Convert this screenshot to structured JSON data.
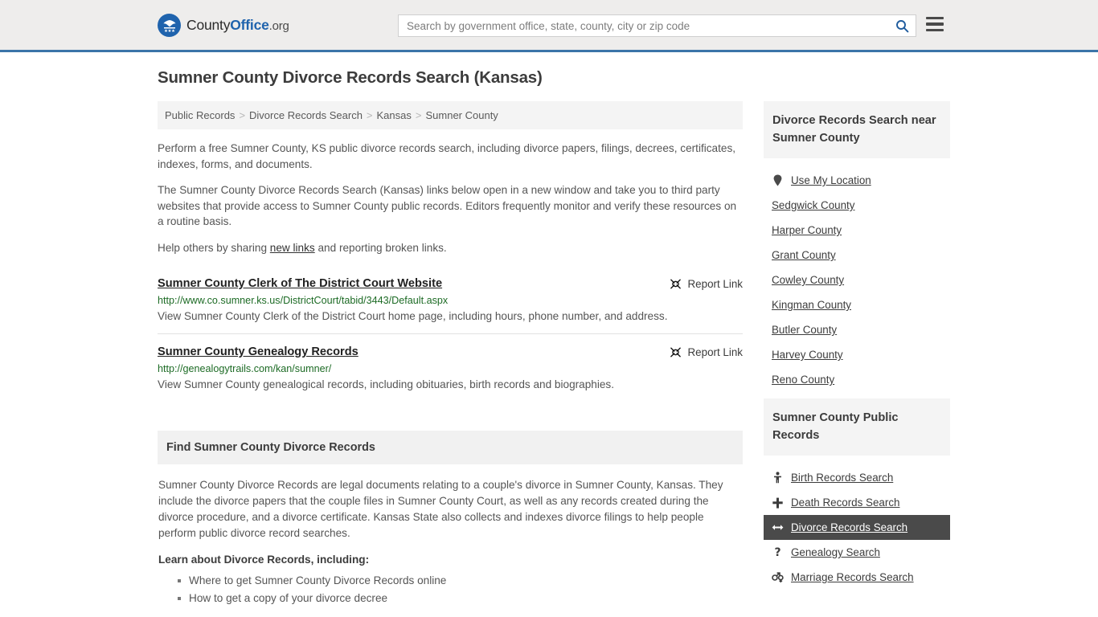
{
  "header": {
    "logo": {
      "part1": "County",
      "part2": "Office",
      "part3": ".org",
      "emblem_icon": "eagle-shield-icon"
    },
    "search": {
      "placeholder": "Search by government office, state, county, city or zip code",
      "value": "",
      "search_icon": "search-icon"
    },
    "menu_icon": "hamburger-menu-icon",
    "accent_color": "#3b74a8",
    "background_color": "#eeedec"
  },
  "page_title": "Sumner County Divorce Records Search (Kansas)",
  "breadcrumb": {
    "separator": ">",
    "items": [
      {
        "label": "Public Records"
      },
      {
        "label": "Divorce Records Search"
      },
      {
        "label": "Kansas"
      },
      {
        "label": "Sumner County"
      }
    ]
  },
  "intro": {
    "p1": "Perform a free Sumner County, KS public divorce records search, including divorce papers, filings, decrees, certificates, indexes, forms, and documents.",
    "p2": "The Sumner County Divorce Records Search (Kansas) links below open in a new window and take you to third party websites that provide access to Sumner County public records. Editors frequently monitor and verify these resources on a routine basis.",
    "p3_before": "Help others by sharing ",
    "p3_link": "new links",
    "p3_after": " and reporting broken links."
  },
  "results": [
    {
      "title": "Sumner County Clerk of The District Court Website",
      "url": "http://www.co.sumner.ks.us/DistrictCourt/tabid/3443/Default.aspx",
      "description": "View Sumner County Clerk of the District Court home page, including hours, phone number, and address.",
      "report_label": "Report Link",
      "report_icon": "broken-link-icon"
    },
    {
      "title": "Sumner County Genealogy Records",
      "url": "http://genealogytrails.com/kan/sumner/",
      "description": "View Sumner County genealogical records, including obituaries, birth records and biographies.",
      "report_label": "Report Link",
      "report_icon": "broken-link-icon"
    }
  ],
  "find_section": {
    "heading": "Find Sumner County Divorce Records",
    "body": "Sumner County Divorce Records are legal documents relating to a couple's divorce in Sumner County, Kansas. They include the divorce papers that the couple files in Sumner County Court, as well as any records created during the divorce procedure, and a divorce certificate. Kansas State also collects and indexes divorce filings to help people perform public divorce record searches.",
    "learn_heading": "Learn about Divorce Records, including:",
    "learn_items": [
      "Where to get Sumner County Divorce Records online",
      "How to get a copy of your divorce decree"
    ]
  },
  "sidebar": {
    "nearby_card": {
      "heading": "Divorce Records Search near Sumner County",
      "items": [
        {
          "label": "Use My Location",
          "icon": "map-pin-icon",
          "has_icon": true
        },
        {
          "label": "Sedgwick County",
          "icon": "",
          "has_icon": false
        },
        {
          "label": "Harper County",
          "icon": "",
          "has_icon": false
        },
        {
          "label": "Grant County",
          "icon": "",
          "has_icon": false
        },
        {
          "label": "Cowley County",
          "icon": "",
          "has_icon": false
        },
        {
          "label": "Kingman County",
          "icon": "",
          "has_icon": false
        },
        {
          "label": "Butler County",
          "icon": "",
          "has_icon": false
        },
        {
          "label": "Harvey County",
          "icon": "",
          "has_icon": false
        },
        {
          "label": "Reno County",
          "icon": "",
          "has_icon": false
        }
      ]
    },
    "public_records_card": {
      "heading": "Sumner County Public Records",
      "items": [
        {
          "label": "Birth Records Search",
          "icon": "baby-icon",
          "active": false
        },
        {
          "label": "Death Records Search",
          "icon": "cross-icon",
          "active": false
        },
        {
          "label": "Divorce Records Search",
          "icon": "left-right-arrow-icon",
          "active": true
        },
        {
          "label": "Genealogy Search",
          "icon": "question-mark-icon",
          "active": false
        },
        {
          "label": "Marriage Records Search",
          "icon": "male-female-icon",
          "active": false
        }
      ]
    }
  }
}
